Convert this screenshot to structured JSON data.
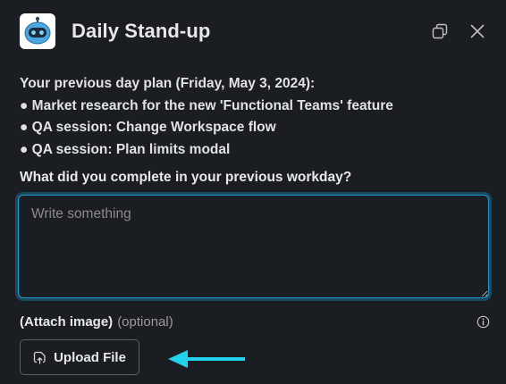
{
  "header": {
    "title": "Daily Stand-up",
    "app_icon": "robot-app-icon",
    "actions": [
      {
        "name": "pop-out-icon"
      },
      {
        "name": "close-icon"
      }
    ]
  },
  "plan": {
    "heading": "Your previous day plan (Friday, May 3, 2024):",
    "items": [
      "● Market research for the new 'Functional Teams' feature",
      "● QA session: Change Workspace flow",
      "● QA session: Plan limits modal"
    ]
  },
  "question": {
    "label": "What did you complete in your previous workday?",
    "value": "",
    "placeholder": "Write something"
  },
  "attachment": {
    "label": "(Attach image)",
    "optional": "(optional)",
    "upload_label": "Upload File"
  },
  "colors": {
    "background": "#1a1d21",
    "focus_ring": "#1d9bd1",
    "annotation_arrow": "#22d3ee"
  }
}
